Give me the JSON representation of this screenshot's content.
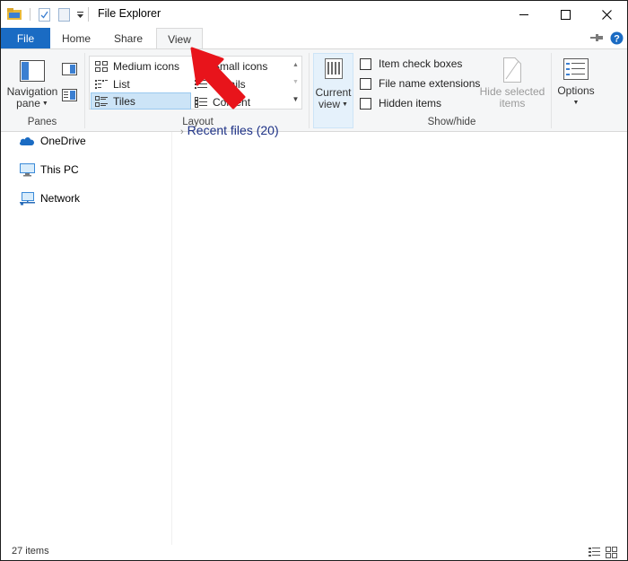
{
  "window": {
    "title": "File Explorer"
  },
  "tabs": [
    {
      "label": "File"
    },
    {
      "label": "Home"
    },
    {
      "label": "Share"
    },
    {
      "label": "View"
    }
  ],
  "ribbon": {
    "panes": {
      "navigation_pane_line1": "Navigation",
      "navigation_pane_line2": "pane",
      "group_label": "Panes"
    },
    "layout": {
      "items": [
        {
          "label": "Medium icons"
        },
        {
          "label": "Small icons"
        },
        {
          "label": "List"
        },
        {
          "label": "Details"
        },
        {
          "label": "Tiles",
          "selected": true
        },
        {
          "label": "Content"
        }
      ],
      "group_label": "Layout"
    },
    "current_view": {
      "line1": "Current",
      "line2": "view"
    },
    "show_hide": {
      "checkboxes": [
        {
          "label": "Item check boxes",
          "checked": false
        },
        {
          "label": "File name extensions",
          "checked": false
        },
        {
          "label": "Hidden items",
          "checked": false
        }
      ],
      "hide_selected_line1": "Hide selected",
      "hide_selected_line2": "items",
      "group_label": "Show/hide"
    },
    "options": {
      "label": "Options"
    }
  },
  "navigation": {
    "items": [
      {
        "label": "OneDrive",
        "icon": "cloud-icon"
      },
      {
        "label": "This PC",
        "icon": "computer-icon"
      },
      {
        "label": "Network",
        "icon": "network-icon"
      }
    ]
  },
  "content": {
    "group_header": "Recent files (20)"
  },
  "status": {
    "item_count": "27 items"
  },
  "colors": {
    "accent": "#1a6bc3",
    "arrow": "#e8141b",
    "selection": "#cce4f7"
  }
}
